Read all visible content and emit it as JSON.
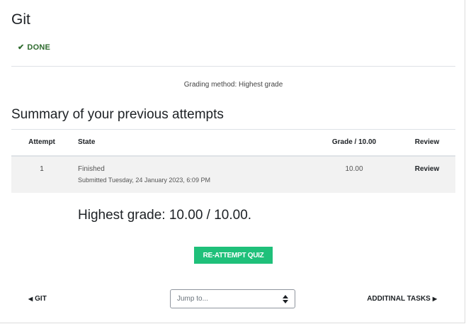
{
  "page": {
    "title": "Git",
    "status": "DONE",
    "grading_method": "Grading method: Highest grade",
    "summary_heading": "Summary of your previous attempts"
  },
  "table": {
    "headers": {
      "attempt": "Attempt",
      "state": "State",
      "grade": "Grade / 10.00",
      "review": "Review"
    },
    "rows": [
      {
        "attempt": "1",
        "state": "Finished",
        "submitted": "Submitted Tuesday, 24 January 2023, 6:09 PM",
        "grade": "10.00",
        "review": "Review"
      }
    ]
  },
  "result": {
    "highest_grade": "Highest grade: 10.00 / 10.00."
  },
  "actions": {
    "reattempt_label": "RE-ATTEMPT QUIZ"
  },
  "navigation": {
    "prev_label": "GIT",
    "jump_placeholder": "Jump to...",
    "next_label": "ADDITINAL TASKS"
  },
  "icons": {
    "done": "check-icon",
    "prev": "triangle-left-icon",
    "next": "triangle-right-icon",
    "select": "select-arrows-icon"
  },
  "colors": {
    "done_green": "#2e6b2e",
    "button_green": "#1fc07a",
    "row_bg": "#f2f2f2"
  }
}
